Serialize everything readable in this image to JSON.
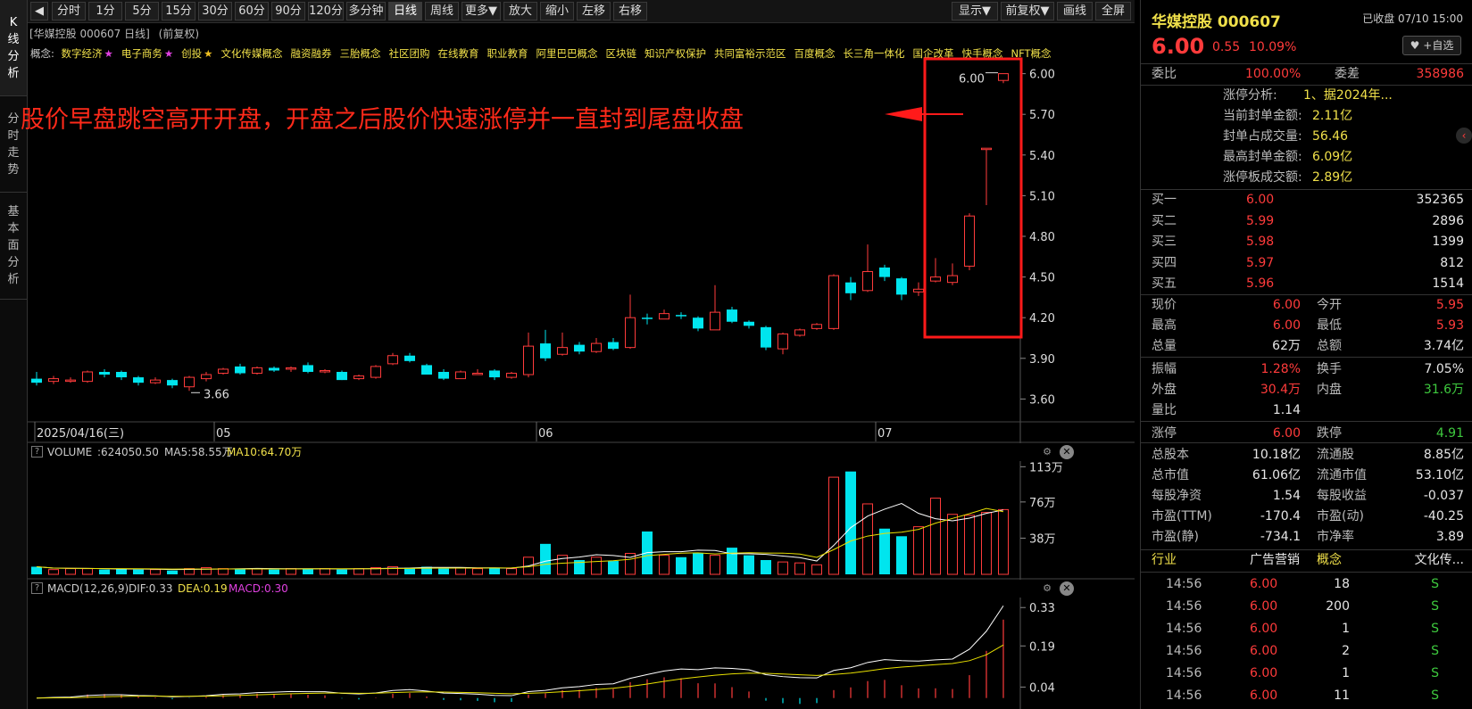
{
  "sidebar": {
    "tabs": [
      "K线分析",
      "分时走势",
      "基本面分析"
    ]
  },
  "toolbar": {
    "items": [
      "分时",
      "1分",
      "5分",
      "15分",
      "30分",
      "60分",
      "90分",
      "120分",
      "多分钟",
      "日线",
      "周线",
      "更多▼",
      "放大",
      "缩小",
      "左移",
      "右移"
    ],
    "right_items": [
      "显示▼",
      "前复权▼",
      "画线",
      "全屏"
    ],
    "active": "日线"
  },
  "chart_header": {
    "title": "[华媒控股 000607 日线]",
    "adjust": "(前复权)"
  },
  "concepts": {
    "label": "概念:",
    "items": [
      "数字经济★",
      "电子商务★",
      "创投★",
      "文化传媒概念",
      "融资融券",
      "三胎概念",
      "社区团购",
      "在线教育",
      "职业教育",
      "阿里巴巴概念",
      "区块链",
      "知识产权保护",
      "共同富裕示范区",
      "百度概念",
      "长三角一体化",
      "国企改革",
      "快手概念",
      "NFT概念"
    ]
  },
  "annotation": {
    "text": "股价早盘跳空高开开盘，开盘之后股价快速涨停并一直封到尾盘收盘"
  },
  "price_axis": {
    "ticks": [
      "6.00",
      "5.70",
      "5.40",
      "5.10",
      "4.80",
      "4.50",
      "4.20",
      "3.90",
      "3.60"
    ]
  },
  "date_axis": {
    "labels": [
      "2025/04/16(三)",
      "05",
      "06",
      "07"
    ]
  },
  "markers": {
    "low": "3.66",
    "high": "6.00"
  },
  "volume_panel": {
    "title": "VOLUME",
    "value": ":624050.50",
    "ma5": "MA5:58.55万",
    "ma10": "MA10:64.70万",
    "ticks": [
      "113万",
      "76万",
      "38万"
    ]
  },
  "macd_panel": {
    "title": "MACD(12,26,9)",
    "dif": "DIF:0.33",
    "dea": "DEA:0.19",
    "macd": "MACD:0.30",
    "ticks": [
      "0.33",
      "0.19",
      "0.04"
    ]
  },
  "colors": {
    "up": "#ff3b3b",
    "down": "#00e5ee",
    "highlight": "#ff1a1a",
    "ma5": "#ffffff",
    "ma10": "#e8e000"
  },
  "chart_data": {
    "type": "candlestick",
    "candles": [
      [
        3.75,
        3.72,
        3.8,
        3.7
      ],
      [
        3.73,
        3.75,
        3.77,
        3.71
      ],
      [
        3.74,
        3.74,
        3.76,
        3.72
      ],
      [
        3.73,
        3.8,
        3.81,
        3.72
      ],
      [
        3.8,
        3.78,
        3.82,
        3.76
      ],
      [
        3.8,
        3.76,
        3.81,
        3.74
      ],
      [
        3.76,
        3.72,
        3.77,
        3.7
      ],
      [
        3.72,
        3.74,
        3.76,
        3.71
      ],
      [
        3.74,
        3.7,
        3.75,
        3.68
      ],
      [
        3.69,
        3.76,
        3.77,
        3.66
      ],
      [
        3.75,
        3.78,
        3.8,
        3.73
      ],
      [
        3.79,
        3.82,
        3.83,
        3.78
      ],
      [
        3.84,
        3.79,
        3.86,
        3.78
      ],
      [
        3.79,
        3.83,
        3.84,
        3.78
      ],
      [
        3.83,
        3.81,
        3.84,
        3.8
      ],
      [
        3.82,
        3.83,
        3.84,
        3.8
      ],
      [
        3.85,
        3.8,
        3.87,
        3.79
      ],
      [
        3.8,
        3.81,
        3.82,
        3.79
      ],
      [
        3.8,
        3.74,
        3.81,
        3.74
      ],
      [
        3.75,
        3.77,
        3.78,
        3.74
      ],
      [
        3.76,
        3.84,
        3.85,
        3.75
      ],
      [
        3.86,
        3.92,
        3.94,
        3.85
      ],
      [
        3.92,
        3.88,
        3.94,
        3.87
      ],
      [
        3.85,
        3.78,
        3.86,
        3.78
      ],
      [
        3.8,
        3.75,
        3.82,
        3.74
      ],
      [
        3.75,
        3.8,
        3.81,
        3.75
      ],
      [
        3.78,
        3.79,
        3.82,
        3.78
      ],
      [
        3.81,
        3.76,
        3.82,
        3.74
      ],
      [
        3.76,
        3.79,
        3.8,
        3.75
      ],
      [
        3.78,
        3.99,
        4.09,
        3.76
      ],
      [
        4.01,
        3.9,
        4.11,
        3.88
      ],
      [
        3.93,
        3.98,
        4.09,
        3.92
      ],
      [
        4.0,
        3.95,
        4.02,
        3.93
      ],
      [
        3.95,
        4.01,
        4.05,
        3.94
      ],
      [
        4.02,
        3.97,
        4.05,
        3.96
      ],
      [
        3.98,
        4.2,
        4.37,
        3.97
      ],
      [
        4.2,
        4.19,
        4.23,
        4.15
      ],
      [
        4.19,
        4.23,
        4.26,
        4.2
      ],
      [
        4.22,
        4.21,
        4.24,
        4.19
      ],
      [
        4.2,
        4.12,
        4.21,
        4.1
      ],
      [
        4.11,
        4.24,
        4.44,
        4.11
      ],
      [
        4.26,
        4.17,
        4.28,
        4.16
      ],
      [
        4.17,
        4.14,
        4.18,
        4.12
      ],
      [
        4.13,
        3.98,
        4.14,
        3.96
      ],
      [
        3.97,
        4.08,
        4.09,
        3.93
      ],
      [
        4.07,
        4.11,
        4.12,
        4.06
      ],
      [
        4.12,
        4.15,
        4.16,
        4.11
      ],
      [
        4.12,
        4.51,
        4.52,
        4.11
      ],
      [
        4.46,
        4.38,
        4.5,
        4.33
      ],
      [
        4.4,
        4.54,
        4.74,
        4.39
      ],
      [
        4.57,
        4.5,
        4.59,
        4.47
      ],
      [
        4.49,
        4.37,
        4.5,
        4.33
      ],
      [
        4.39,
        4.41,
        4.46,
        4.36
      ],
      [
        4.47,
        4.5,
        4.64,
        4.46
      ],
      [
        4.46,
        4.51,
        4.6,
        4.44
      ],
      [
        4.58,
        4.95,
        4.97,
        4.55
      ],
      [
        5.45,
        5.45,
        5.45,
        5.03
      ],
      [
        5.95,
        6.0,
        6.0,
        5.93
      ]
    ],
    "volume": [
      8,
      5,
      6,
      6,
      5,
      6,
      5,
      5,
      4,
      6,
      7,
      6,
      6,
      6,
      5,
      6,
      6,
      6,
      5,
      6,
      7,
      8,
      7,
      8,
      6,
      7,
      6,
      7,
      6,
      18,
      32,
      20,
      15,
      18,
      14,
      22,
      45,
      20,
      18,
      22,
      20,
      28,
      20,
      15,
      13,
      12,
      10,
      102,
      108,
      74,
      48,
      40,
      50,
      80,
      63,
      62,
      65,
      68
    ],
    "ylim": [
      3.55,
      6.05
    ]
  },
  "right_panel": {
    "name": "华媒控股 000607",
    "status": "已收盘 07/10 15:00",
    "price": "6.00",
    "change": "0.55",
    "pct": "10.09%",
    "fav": "+自选",
    "weibi_label": "委比",
    "weibi": "100.00%",
    "weicha_label": "委差",
    "weicha": "358986",
    "limit_info": [
      {
        "k": "涨停分析:",
        "v": "1、据2024年..."
      },
      {
        "k": "当前封单金额:",
        "v": "2.11亿"
      },
      {
        "k": "封单占成交量:",
        "v": "56.46"
      },
      {
        "k": "最高封单金额:",
        "v": "6.09亿"
      },
      {
        "k": "涨停板成交额:",
        "v": "2.89亿"
      }
    ],
    "bids": [
      {
        "l": "买一",
        "p": "6.00",
        "v": "352365"
      },
      {
        "l": "买二",
        "p": "5.99",
        "v": "2896"
      },
      {
        "l": "买三",
        "p": "5.98",
        "v": "1399"
      },
      {
        "l": "买四",
        "p": "5.97",
        "v": "812"
      },
      {
        "l": "买五",
        "p": "5.96",
        "v": "1514"
      }
    ],
    "stats": [
      [
        "现价",
        "6.00",
        "今开",
        "5.95"
      ],
      [
        "最高",
        "6.00",
        "最低",
        "5.93"
      ],
      [
        "总量",
        "62万",
        "总额",
        "3.74亿"
      ],
      [
        "振幅",
        "1.28%",
        "换手",
        "7.05%"
      ],
      [
        "外盘",
        "30.4万",
        "内盘",
        "31.6万"
      ],
      [
        "量比",
        "1.14",
        "",
        ""
      ],
      [
        "涨停",
        "6.00",
        "跌停",
        "4.91"
      ],
      [
        "总股本",
        "10.18亿",
        "流通股",
        "8.85亿"
      ],
      [
        "总市值",
        "61.06亿",
        "流通市值",
        "53.10亿"
      ],
      [
        "每股净资",
        "1.54",
        "每股收益",
        "-0.037"
      ],
      [
        "市盈(TTM)",
        "-170.4",
        "市盈(动)",
        "-40.25"
      ],
      [
        "市盈(静)",
        "-734.1",
        "市净率",
        "3.89"
      ]
    ],
    "industry": [
      "行业",
      "广告营销",
      "概念",
      "文化传..."
    ],
    "trades": [
      [
        "14:56",
        "6.00",
        "18",
        "S"
      ],
      [
        "14:56",
        "6.00",
        "200",
        "S"
      ],
      [
        "14:56",
        "6.00",
        "1",
        "S"
      ],
      [
        "14:56",
        "6.00",
        "2",
        "S"
      ],
      [
        "14:56",
        "6.00",
        "1",
        "S"
      ],
      [
        "14:56",
        "6.00",
        "11",
        "S"
      ]
    ]
  }
}
